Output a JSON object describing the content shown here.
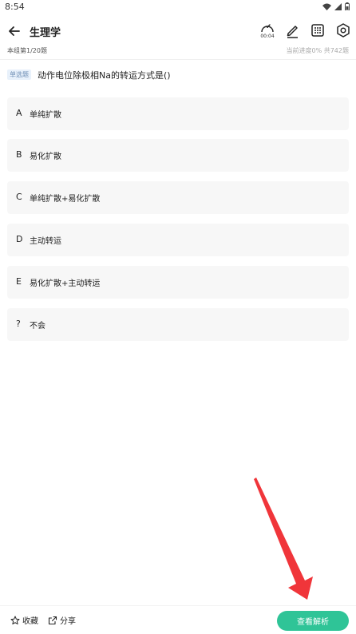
{
  "status_bar": {
    "time": "8:54"
  },
  "app_bar": {
    "title": "生理学",
    "timer": "00:04"
  },
  "progress": {
    "group": "本组第1/20题",
    "right": "当前进度0%  共742题"
  },
  "question": {
    "type": "单选题",
    "text": "动作电位除极相Na的转运方式是()"
  },
  "options": [
    {
      "letter": "A",
      "text": "单纯扩散"
    },
    {
      "letter": "B",
      "text": "易化扩散"
    },
    {
      "letter": "C",
      "text": "单纯扩散+易化扩散"
    },
    {
      "letter": "D",
      "text": "主动转运"
    },
    {
      "letter": "E",
      "text": "易化扩散+主动转运"
    },
    {
      "letter": "?",
      "text": "不会"
    }
  ],
  "bottom_bar": {
    "favorite_label": "收藏",
    "share_label": "分享",
    "view_analysis_label": "查看解析"
  },
  "colors": {
    "accent": "#2fc497",
    "arrow": "#f0353a",
    "option_bg": "#f7f7f7"
  },
  "icons": [
    "back-arrow-icon",
    "timer-icon",
    "edit-icon",
    "grid-icon",
    "settings-icon",
    "star-icon",
    "share-icon",
    "wifi-icon",
    "signal-icon",
    "battery-icon"
  ]
}
